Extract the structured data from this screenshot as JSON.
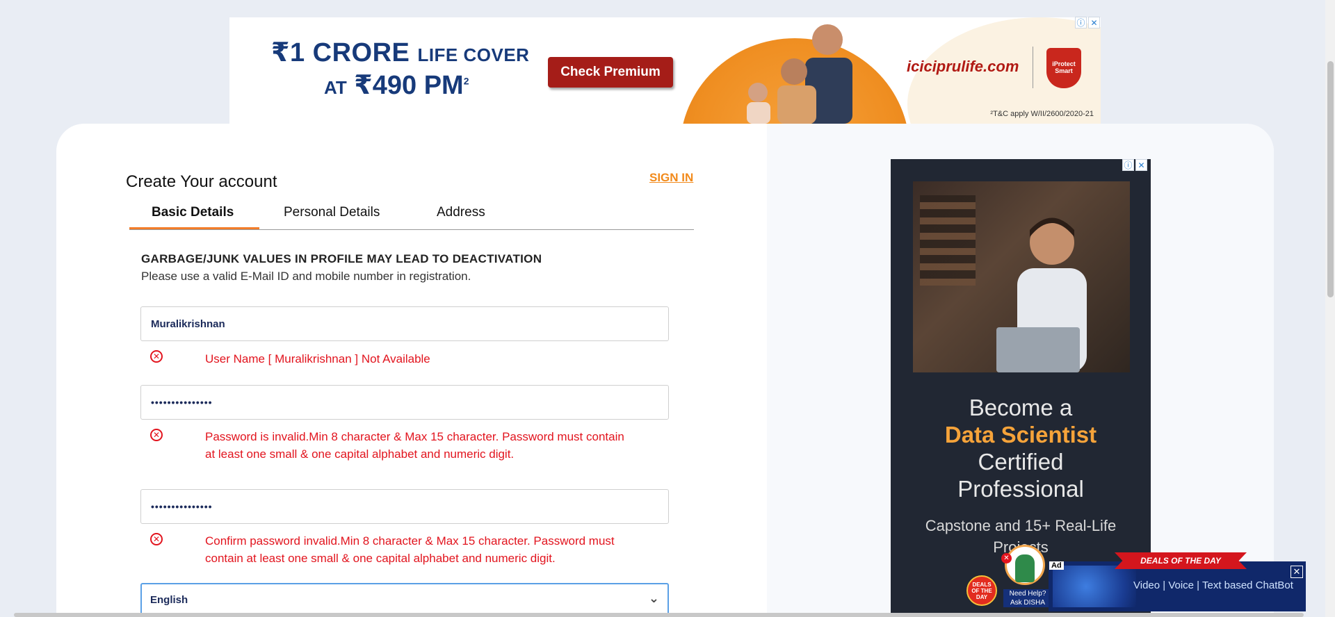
{
  "top_ad": {
    "headline_amount": "₹1 CRORE",
    "headline_suffix": "LIFE COVER",
    "premium_prefix": "AT",
    "premium_amount": "₹490 PM",
    "premium_sup": "2",
    "cta_label": "Check Premium",
    "brand": "iciciprulife.com",
    "shield_text": "iProtect Smart",
    "disclaimer": "²T&C apply W/II/2600/2020-21"
  },
  "form": {
    "title": "Create Your account",
    "signin_label": "SIGN IN",
    "tabs": [
      "Basic Details",
      "Personal Details",
      "Address"
    ],
    "active_tab": "Basic Details",
    "warning_title": "GARBAGE/JUNK VALUES IN PROFILE MAY LEAD TO DEACTIVATION",
    "warning_sub": "Please use a valid E-Mail ID and mobile number in registration.",
    "username_value": "Muralikrishnan",
    "username_error": "User Name [ Muralikrishnan ] Not Available",
    "password_value": "•••••••••••••••",
    "password_error": "Password is invalid.Min 8 character & Max 15 character. Password must contain at least one small & one capital alphabet and numeric digit.",
    "confirm_value": "•••••••••••••••",
    "confirm_error": "Confirm password invalid.Min 8 character & Max 15 character. Password must contain at least one small & one capital alphabet and numeric digit.",
    "language_value": "English"
  },
  "side_ad": {
    "line1": "Become a",
    "line2": "Data Scientist",
    "line3": "Certified",
    "line4": "Professional",
    "sub": "Capstone and 15+ Real-Life Projects"
  },
  "chat": {
    "ad_tag": "Ad",
    "ribbon": "DEALS OF THE DAY",
    "text": "Video | Voice | Text based ChatBot",
    "disha_label_1": "Need Help?",
    "disha_label_2": "Ask DISHA",
    "deals_badge": "DEALS OF THE DAY"
  },
  "colors": {
    "accent": "#f27d2a",
    "error": "#e2141e",
    "field_text": "#1b2a5a"
  }
}
